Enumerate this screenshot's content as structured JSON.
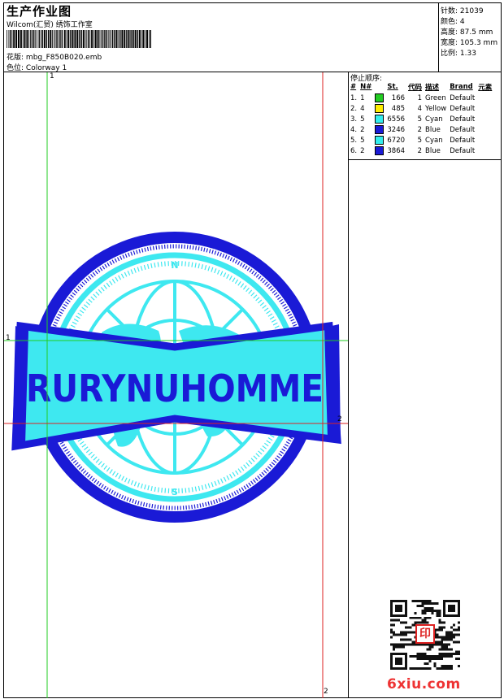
{
  "header": {
    "title": "生产作业图",
    "company": "Wilcom(汇贸) 绣饰工作室",
    "design_label": "花版:",
    "design_value": "mbg_F850B020.emb",
    "colorway_label": "色位:",
    "colorway_value": "Colorway 1"
  },
  "stats": [
    {
      "label": "针数:",
      "value": "21039"
    },
    {
      "label": "颜色:",
      "value": "4"
    },
    {
      "label": "高度:",
      "value": "87.5 mm"
    },
    {
      "label": "宽度:",
      "value": "105.3 mm"
    },
    {
      "label": "比例:",
      "value": "1.33"
    }
  ],
  "sequence": {
    "title": "停止顺序:",
    "headers": [
      "#",
      "N#",
      "St.",
      "代码",
      "描述",
      "Brand",
      "元素"
    ],
    "rows": [
      {
        "idx": "1.",
        "n": "1",
        "color": "#22cc22",
        "st": "166",
        "code": "1",
        "desc": "Green",
        "brand": "Default"
      },
      {
        "idx": "2.",
        "n": "4",
        "color": "#ffee00",
        "st": "485",
        "code": "4",
        "desc": "Yellow",
        "brand": "Default"
      },
      {
        "idx": "3.",
        "n": "5",
        "color": "#33eeee",
        "st": "6556",
        "code": "5",
        "desc": "Cyan",
        "brand": "Default"
      },
      {
        "idx": "4.",
        "n": "2",
        "color": "#1a1ad6",
        "st": "3246",
        "code": "2",
        "desc": "Blue",
        "brand": "Default"
      },
      {
        "idx": "5.",
        "n": "5",
        "color": "#33eeee",
        "st": "6720",
        "code": "5",
        "desc": "Cyan",
        "brand": "Default"
      },
      {
        "idx": "6.",
        "n": "2",
        "color": "#1a1ad6",
        "st": "3864",
        "code": "2",
        "desc": "Blue",
        "brand": "Default"
      }
    ]
  },
  "design": {
    "text": "RURYNUHOMME",
    "colors": {
      "blue": "#1a1ad6",
      "cyan": "#3ee8f0",
      "green": "#22cc22",
      "red": "#dd2222"
    }
  },
  "guides": {
    "v1": "1",
    "h1": "1",
    "h2": "2",
    "v2": "2"
  },
  "watermark": "6xiu.com",
  "seal_text": "印"
}
